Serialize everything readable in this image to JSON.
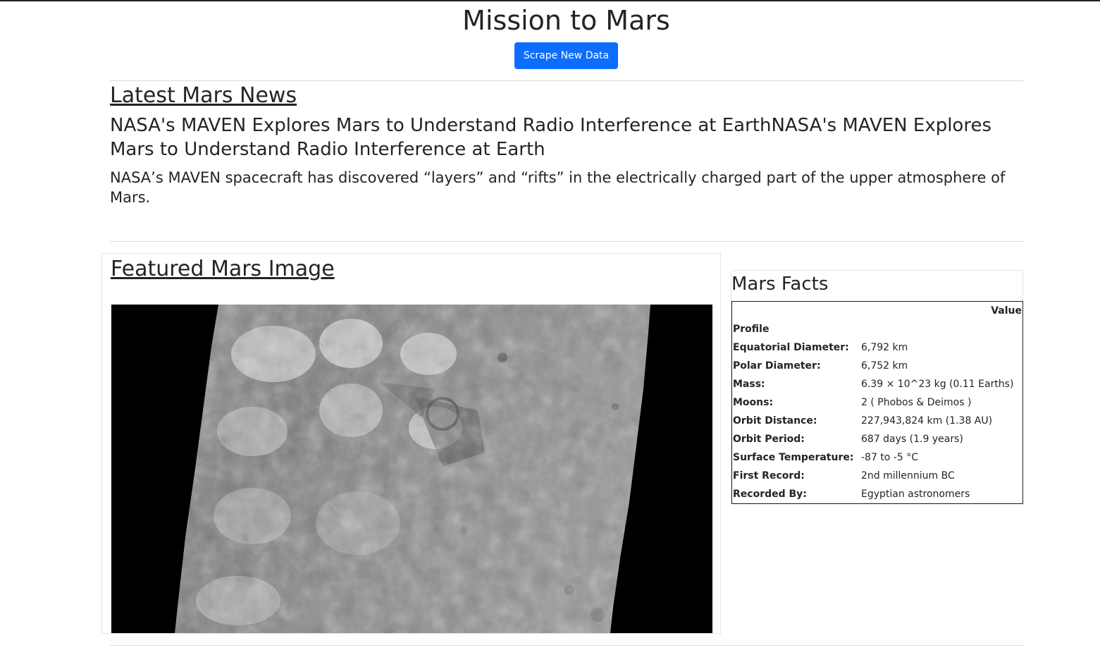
{
  "header": {
    "title": "Mission to Mars",
    "scrape_button_label": "Scrape New Data"
  },
  "news": {
    "heading": "Latest Mars News",
    "title": "NASA's MAVEN Explores Mars to Understand Radio Interference at EarthNASA's MAVEN Explores Mars to Understand Radio Interference at Earth",
    "paragraph": "NASA’s MAVEN spacecraft has discovered “layers” and “rifts” in the electrically charged part of the upper atmosphere of Mars."
  },
  "featured_image": {
    "heading": "Featured Mars Image"
  },
  "facts": {
    "heading": "Mars Facts",
    "column_header": "Value",
    "index_header": "Profile",
    "rows": [
      {
        "label": "Equatorial Diameter:",
        "value": "6,792 km"
      },
      {
        "label": "Polar Diameter:",
        "value": "6,752 km"
      },
      {
        "label": "Mass:",
        "value": "6.39 × 10^23 kg (0.11 Earths)"
      },
      {
        "label": "Moons:",
        "value": "2 ( Phobos & Deimos )"
      },
      {
        "label": "Orbit Distance:",
        "value": "227,943,824 km (1.38 AU)"
      },
      {
        "label": "Orbit Period:",
        "value": "687 days (1.9 years)"
      },
      {
        "label": "Surface Temperature:",
        "value": "-87 to -5 °C"
      },
      {
        "label": "First Record:",
        "value": "2nd millennium BC"
      },
      {
        "label": "Recorded By:",
        "value": "Egyptian astronomers"
      }
    ]
  },
  "colors": {
    "button": "#0d6efd",
    "text": "#212529"
  }
}
